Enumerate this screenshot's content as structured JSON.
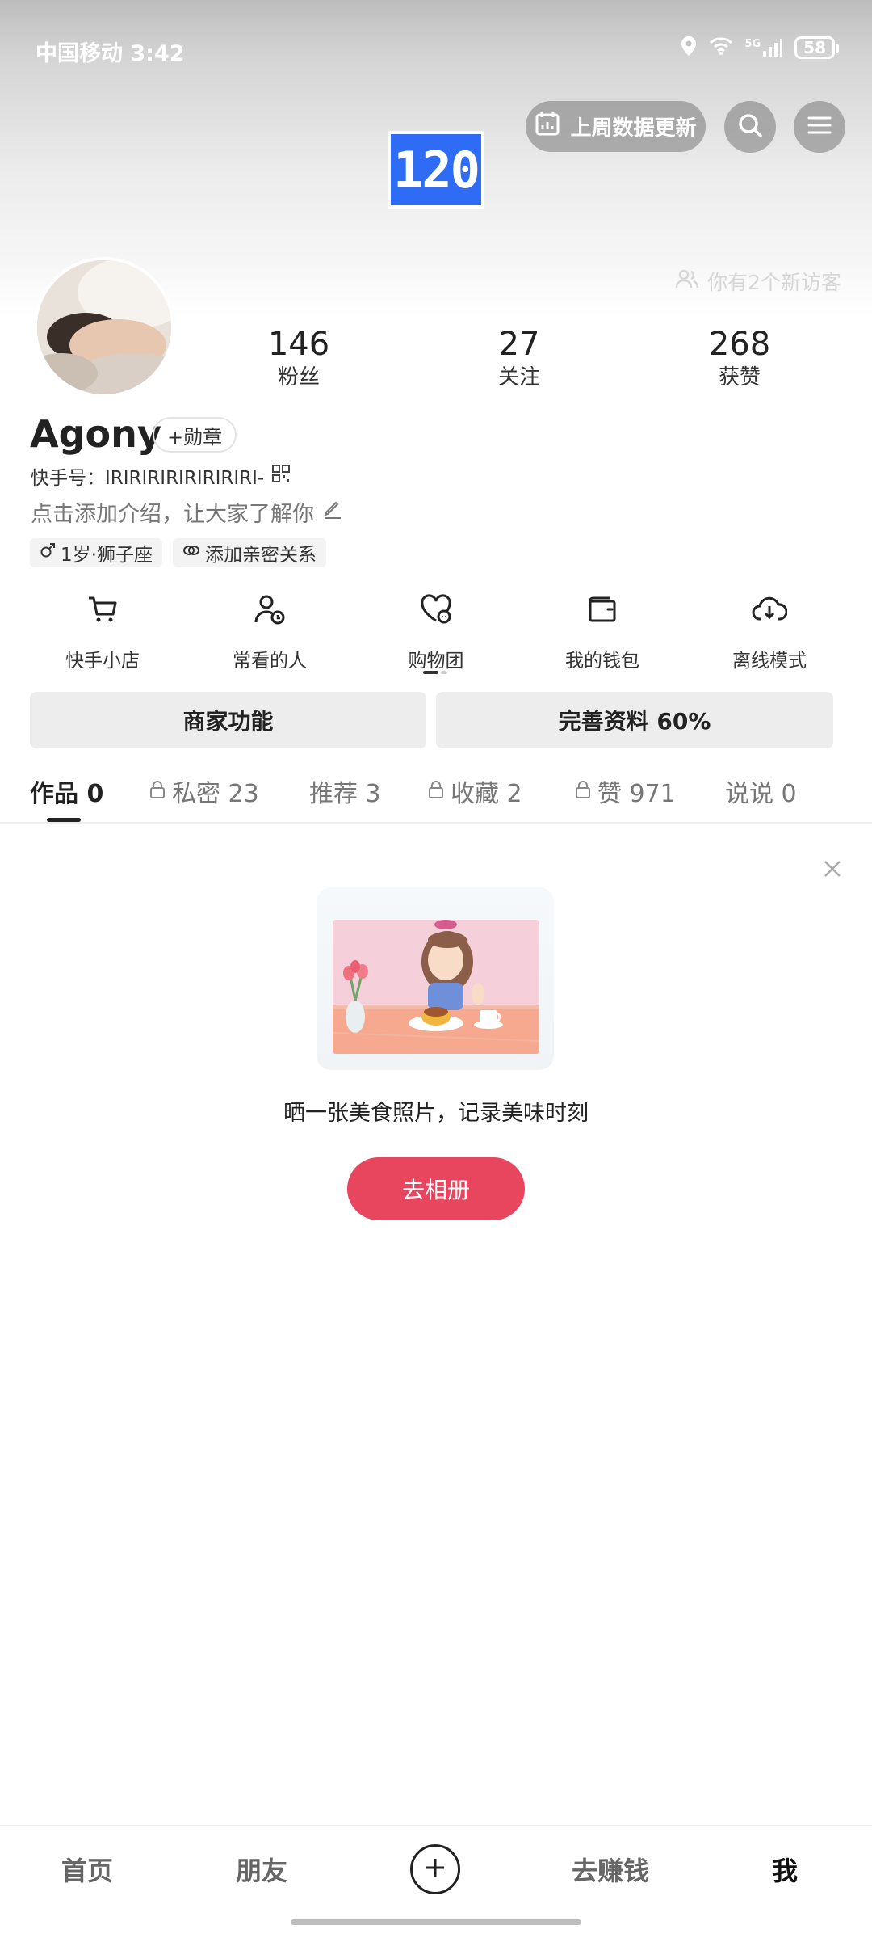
{
  "status_bar": {
    "carrier_time": "中国移动 3:42",
    "network": "5G",
    "battery": "58"
  },
  "header": {
    "logo_text": "120",
    "update_button": "上周数据更新",
    "visitors_text": "你有2个新访客"
  },
  "profile": {
    "stats": [
      {
        "value": "146",
        "label": "粉丝"
      },
      {
        "value": "27",
        "label": "关注"
      },
      {
        "value": "268",
        "label": "获赞"
      }
    ],
    "username": "Agony",
    "medal_label": "+勋章",
    "kuaishou_id": "快手号：IRIRIRIRIRIRIRIRI-",
    "bio_placeholder": "点击添加介绍，让大家了解你",
    "tags": {
      "age_sign": "1岁·狮子座",
      "relation": "添加亲密关系"
    }
  },
  "tools": [
    {
      "label": "快手小店",
      "icon": "cart-icon"
    },
    {
      "label": "常看的人",
      "icon": "person-clock-icon"
    },
    {
      "label": "购物团",
      "icon": "heart-chat-icon"
    },
    {
      "label": "我的钱包",
      "icon": "wallet-icon"
    },
    {
      "label": "离线模式",
      "icon": "download-cloud-icon"
    }
  ],
  "actions": {
    "merchant": "商家功能",
    "complete_profile": "完善资料 60%"
  },
  "tabs": [
    {
      "label": "作品 0",
      "locked": false
    },
    {
      "label": "私密 23",
      "locked": true
    },
    {
      "label": "推荐 3",
      "locked": false
    },
    {
      "label": "收藏 2",
      "locked": true
    },
    {
      "label": "赞 971",
      "locked": true
    },
    {
      "label": "说说 0",
      "locked": false
    }
  ],
  "empty_state": {
    "message": "晒一张美食照片，记录美味时刻",
    "button": "去相册"
  },
  "bottom_nav": {
    "home": "首页",
    "friends": "朋友",
    "earn": "去赚钱",
    "me": "我"
  },
  "colors": {
    "accent": "#e8465e",
    "logo_blue": "#2f6cf5"
  }
}
